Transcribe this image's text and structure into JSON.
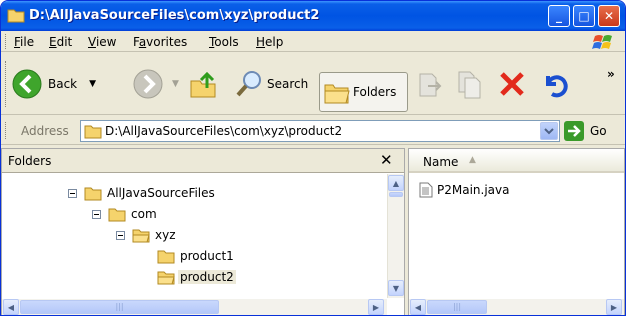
{
  "window": {
    "title": "D:\\AllJavaSourceFiles\\com\\xyz\\product2",
    "minimize_label": "_",
    "maximize_label": "□",
    "close_label": "✕"
  },
  "menu": [
    {
      "pre": "",
      "key": "F",
      "post": "ile"
    },
    {
      "pre": "",
      "key": "E",
      "post": "dit"
    },
    {
      "pre": "",
      "key": "V",
      "post": "iew"
    },
    {
      "pre": "F",
      "key": "a",
      "post": "vorites"
    },
    {
      "pre": "",
      "key": "T",
      "post": "ools"
    },
    {
      "pre": "",
      "key": "H",
      "post": "elp"
    }
  ],
  "toolbar": {
    "back_label": "Back",
    "search_label": "Search",
    "folders_label": "Folders",
    "overflow": "»"
  },
  "address": {
    "label": "Address",
    "value": "D:\\AllJavaSourceFiles\\com\\xyz\\product2",
    "go_label": "Go"
  },
  "folders_pane": {
    "title": "Folders",
    "close": "✕",
    "tree": [
      "AllJavaSourceFiles",
      "com",
      "xyz",
      "product1",
      "product2"
    ],
    "hscroll_grip": "|||"
  },
  "files_pane": {
    "column_name": "Name",
    "sort_arrow": "▲",
    "files": [
      "P2Main.java"
    ],
    "hscroll_grip": "|||"
  },
  "colors": {
    "titlebar": "#0054e3",
    "close_button": "#c9381b",
    "go_arrow": "#3a9a2a",
    "delete_x": "#e22a1c",
    "folder": "#f5d36c"
  }
}
